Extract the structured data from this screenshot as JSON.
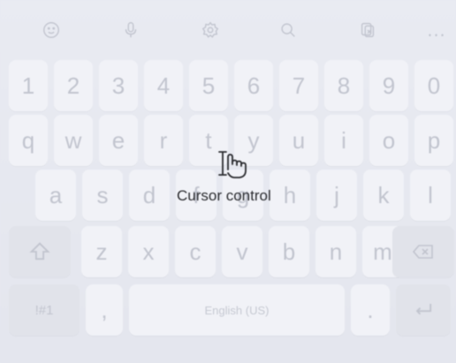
{
  "toolbar": {
    "icons": [
      "emoji-icon",
      "microphone-icon",
      "settings-icon",
      "search-icon",
      "clipboard-icon",
      "more-icon"
    ],
    "more_label": "..."
  },
  "keys": {
    "row1": [
      "1",
      "2",
      "3",
      "4",
      "5",
      "6",
      "7",
      "8",
      "9",
      "0"
    ],
    "row2": [
      "q",
      "w",
      "e",
      "r",
      "t",
      "y",
      "u",
      "i",
      "o",
      "p"
    ],
    "row3": [
      "a",
      "s",
      "d",
      "f",
      "g",
      "h",
      "j",
      "k",
      "l"
    ],
    "row4": [
      "z",
      "x",
      "c",
      "v",
      "b",
      "n",
      "m"
    ],
    "symbols_label": "!#1",
    "comma_label": ",",
    "space_label": "English (US)",
    "period_label": "."
  },
  "overlay": {
    "tooltip": "Cursor control",
    "icon": "cursor-hand-icon"
  },
  "colors": {
    "background": "#e6e8ef",
    "key": "#f1f2f7",
    "key_text": "#c2c5cf",
    "tooltip_text": "#2b2c30"
  }
}
